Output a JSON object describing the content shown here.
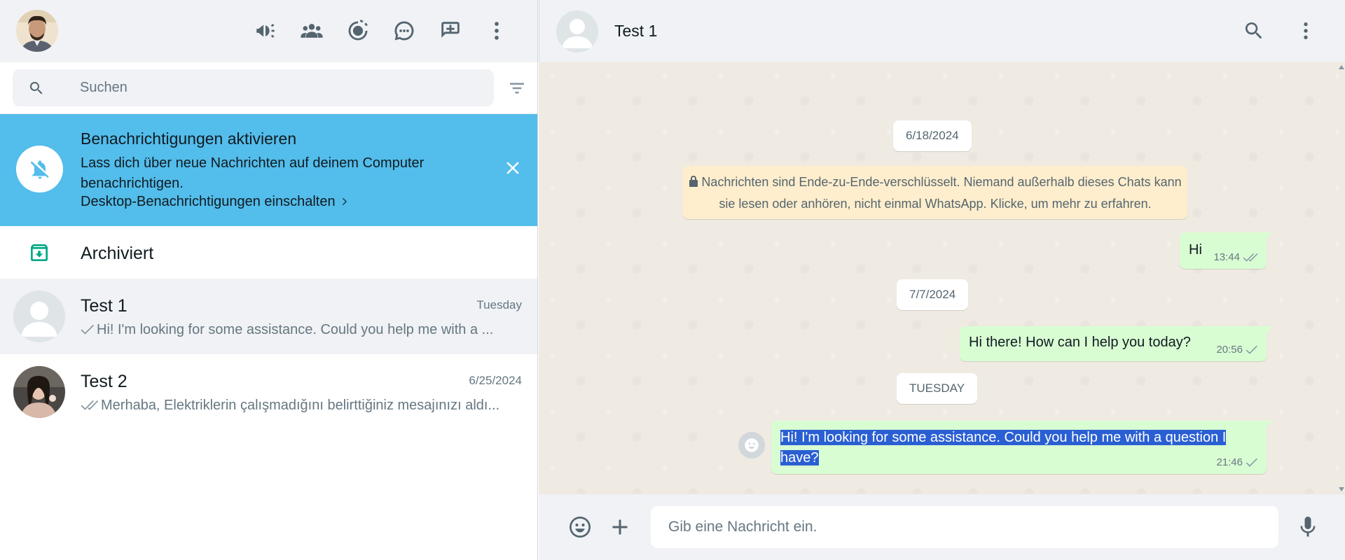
{
  "left_header": {
    "icons": [
      "megaphone-icon",
      "communities-icon",
      "status-icon",
      "channels-icon",
      "new-chat-icon",
      "menu-icon"
    ]
  },
  "search": {
    "placeholder": "Suchen"
  },
  "notification": {
    "title": "Benachrichtigungen aktivieren",
    "body": "Lass dich über neue Nachrichten auf deinem Computer benachrichtigen.",
    "link": "Desktop-Benachrichtigungen einschalten"
  },
  "archived": {
    "label": "Archiviert"
  },
  "chats": [
    {
      "name": "Test 1",
      "date": "Tuesday",
      "preview": "Hi! I'm looking for some assistance. Could you help me with a ...",
      "tick": "single"
    },
    {
      "name": "Test 2",
      "date": "6/25/2024",
      "preview": "Merhaba, Elektriklerin çalışmadığını belirttiğiniz mesajınızı aldı...",
      "tick": "double"
    }
  ],
  "conversation": {
    "contact_name": "Test 1",
    "date_chips": [
      "6/18/2024",
      "7/7/2024",
      "TUESDAY"
    ],
    "encryption_notice": "Nachrichten sind Ende-zu-Ende-verschlüsselt. Niemand außerhalb dieses Chats kann sie lesen oder anhören, nicht einmal WhatsApp. Klicke, um mehr zu erfahren.",
    "messages": [
      {
        "text": "Hi",
        "time": "13:44",
        "status": "double-tick"
      },
      {
        "text": "Hi there! How can I help you today?",
        "time": "20:56",
        "status": "single-tick"
      },
      {
        "text": "Hi! I'm looking for some assistance. Could you help me with a question I have?",
        "time": "21:46",
        "status": "single-tick",
        "selected": true
      }
    ]
  },
  "composer": {
    "placeholder": "Gib eine Nachricht ein."
  },
  "colors": {
    "accent": "#00a884",
    "notification_bg": "#53bdeb",
    "outgoing_bubble": "#d9fdd3",
    "encryption_bg": "#ffeecd",
    "panel_bg": "#f0f2f5",
    "chat_bg": "#efeae2",
    "selection": "#2a5fd3"
  }
}
